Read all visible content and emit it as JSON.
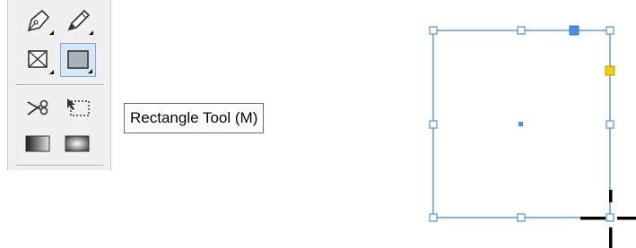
{
  "toolbar": {
    "tools": [
      {
        "name": "Pen Tool",
        "icon": "pen-icon",
        "active": false
      },
      {
        "name": "Pencil Tool",
        "icon": "pencil-icon",
        "active": false
      },
      {
        "name": "Rectangle Frame Tool",
        "icon": "rectangle-frame-icon",
        "active": false
      },
      {
        "name": "Rectangle Tool",
        "icon": "rectangle-icon",
        "active": true
      },
      {
        "name": "Scissors Tool",
        "icon": "scissors-icon",
        "active": false
      },
      {
        "name": "Free Transform Tool",
        "icon": "free-transform-icon",
        "active": false
      },
      {
        "name": "Gradient Swatch Tool",
        "icon": "gradient-swatch-icon",
        "active": false
      },
      {
        "name": "Gradient Feather Tool",
        "icon": "gradient-feather-icon",
        "active": false
      }
    ]
  },
  "tooltip": {
    "text": "Rectangle Tool (M)"
  },
  "canvas": {
    "selection_color": "#5b9bd5",
    "handle_fill": "#ffffff",
    "reference_point_color": "#4a8fe0",
    "gap_handle_color": "#f5d000",
    "crosshair_cursor": "crosshair-cursor-icon"
  }
}
